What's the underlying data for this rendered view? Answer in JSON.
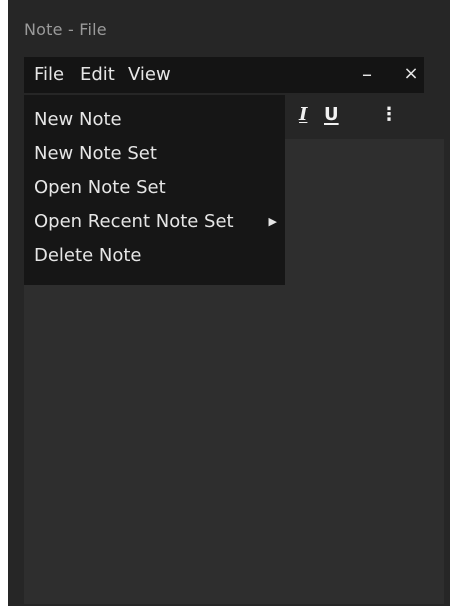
{
  "window": {
    "title": "Note - File"
  },
  "menubar": {
    "menus": [
      "File",
      "Edit",
      "View"
    ],
    "minimize_glyph": "–",
    "close_glyph": "×"
  },
  "toolbar": {
    "italic_label": "I",
    "underline_label": "U",
    "more_label": "⋮"
  },
  "file_menu": {
    "items": [
      {
        "label": "New Note"
      },
      {
        "label": "New Note Set"
      },
      {
        "label": "Open Note Set"
      },
      {
        "label": "Open Recent Note Set",
        "submenu_glyph": "▶"
      },
      {
        "label": "Delete Note"
      }
    ]
  },
  "colors": {
    "window_bg": "#262626",
    "menubar_bg": "#141414",
    "dropdown_bg": "#161616",
    "editor_bg": "#2e2e2e",
    "text": "#e6e6e6",
    "title_text": "#9a9a9a"
  },
  "icons": {
    "italic": "italic-icon",
    "underline": "underline-icon",
    "more": "more-vertical-icon",
    "submenu": "chevron-right-icon"
  }
}
